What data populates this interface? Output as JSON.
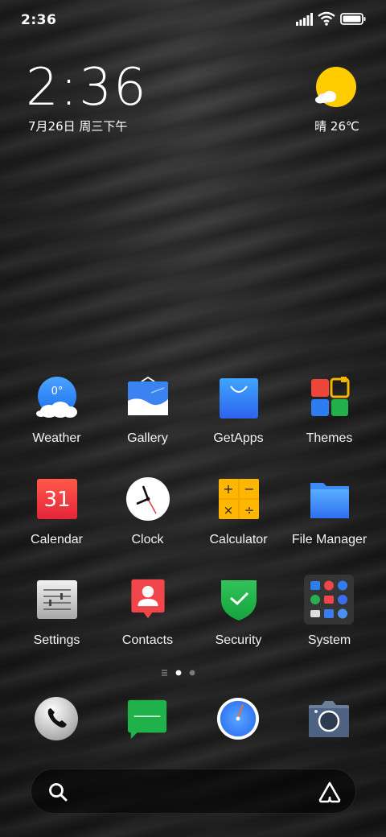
{
  "status_bar": {
    "time": "2:36",
    "icons": [
      "signal-icon",
      "wifi-icon",
      "battery-icon"
    ]
  },
  "clock_widget": {
    "time": "2:36",
    "date": "7月26日 周三下午"
  },
  "weather_widget": {
    "text": "晴 26℃",
    "icon": "sun-cloud-icon"
  },
  "apps": {
    "weather": {
      "label": "Weather",
      "icon_text": "0°"
    },
    "gallery": {
      "label": "Gallery"
    },
    "getapps": {
      "label": "GetApps"
    },
    "themes": {
      "label": "Themes"
    },
    "calendar": {
      "label": "Calendar",
      "icon_text": "31"
    },
    "clock": {
      "label": "Clock"
    },
    "calculator": {
      "label": "Calculator"
    },
    "file_manager": {
      "label": "File Manager"
    },
    "settings": {
      "label": "Settings"
    },
    "contacts": {
      "label": "Contacts"
    },
    "security": {
      "label": "Security"
    },
    "system": {
      "label": "System"
    }
  },
  "dock": [
    "phone",
    "messages",
    "browser",
    "camera"
  ],
  "page_indicator": {
    "pages": 2,
    "current": 1
  },
  "search_bar": {
    "icons": [
      "search-icon",
      "assistant-icon"
    ]
  },
  "colors": {
    "accent_blue": "#3d7cf2",
    "security_green": "#1fb24a",
    "calendar_red": "#f0383b"
  }
}
